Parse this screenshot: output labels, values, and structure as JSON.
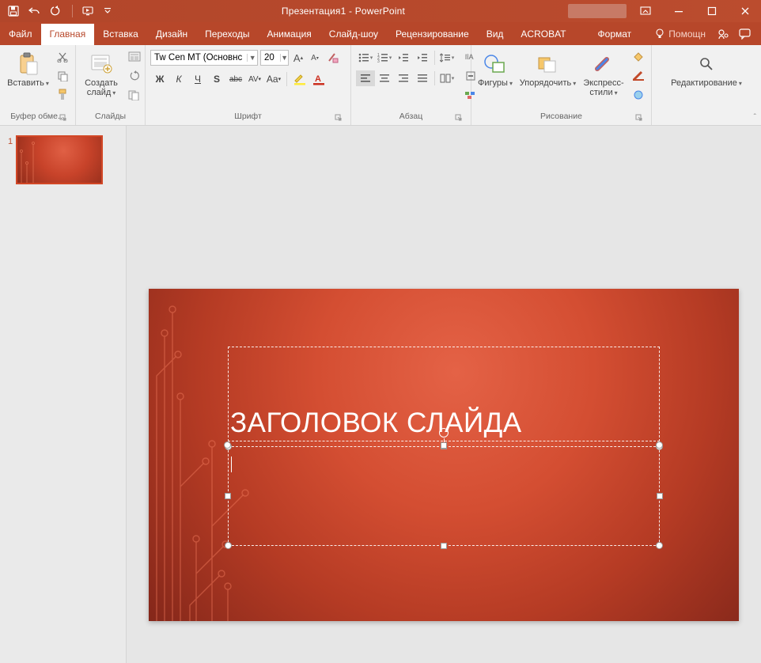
{
  "titlebar": {
    "title": "Презентация1 - PowerPoint"
  },
  "tabs": {
    "file": "Файл",
    "home": "Главная",
    "insert": "Вставка",
    "design": "Дизайн",
    "transitions": "Переходы",
    "animation": "Анимация",
    "slideshow": "Слайд-шоу",
    "review": "Рецензирование",
    "view": "Вид",
    "acrobat": "ACROBAT",
    "format": "Формат",
    "tell_me": "Помощн"
  },
  "ribbon": {
    "clipboard": {
      "group": "Буфер обме...",
      "paste": "Вставить"
    },
    "slides": {
      "group": "Слайды",
      "new_slide": "Создать\nслайд"
    },
    "font": {
      "group": "Шрифт",
      "name": "Tw Cen MT (Основнс",
      "size": "20",
      "bold": "Ж",
      "italic": "К",
      "underline": "Ч",
      "shadow": "S",
      "strike": "abc",
      "spacing": "AV",
      "case": "Aa"
    },
    "paragraph": {
      "group": "Абзац"
    },
    "drawing": {
      "group": "Рисование",
      "shapes": "Фигуры",
      "arrange": "Упорядочить",
      "quick_styles": "Экспресс-\nстили"
    },
    "editing": {
      "group": "Редактирование"
    }
  },
  "thumbnails": {
    "slide1_num": "1"
  },
  "slide": {
    "title_placeholder": "ЗАГОЛОВОК СЛАЙДА"
  }
}
